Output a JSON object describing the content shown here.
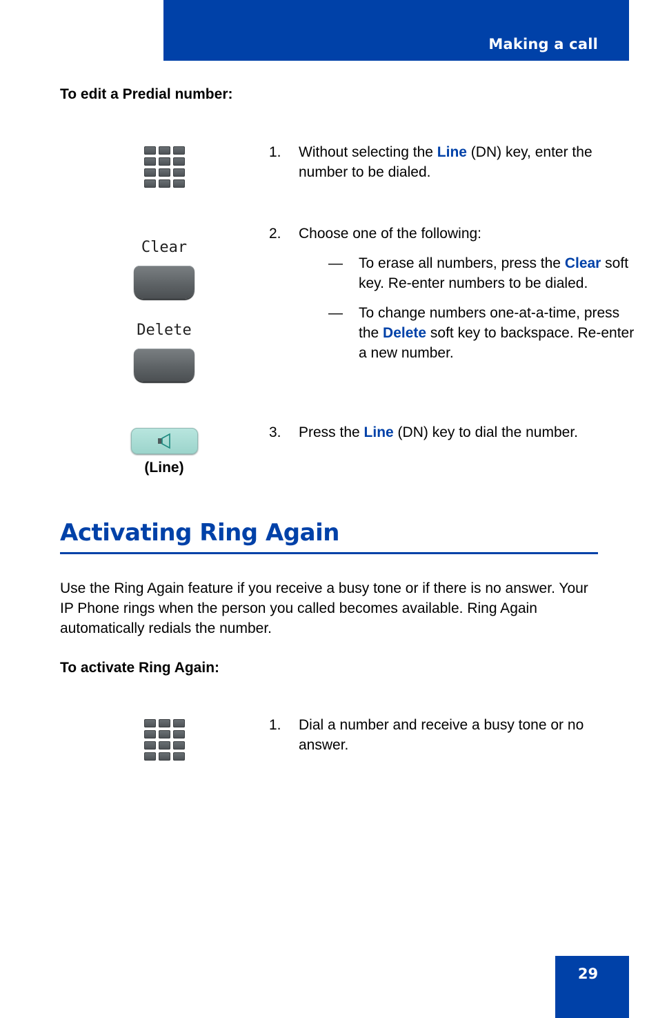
{
  "header": {
    "title": "Making a call"
  },
  "section1": {
    "subheading": "To edit a Predial number:",
    "steps": [
      {
        "number": "1.",
        "text_before": "Without selecting the ",
        "highlight": "Line",
        "text_after": " (DN) key, enter the number to be dialed.",
        "icon": "keypad-icon"
      },
      {
        "number": "2.",
        "text": "Choose one of the following:",
        "options": [
          {
            "dash": "—",
            "text_before": "To erase all numbers, press the ",
            "highlight": "Clear",
            "text_after": " soft key. Re-enter numbers to be dialed.",
            "key_label": "Clear"
          },
          {
            "dash": "—",
            "text_before": "To change numbers one-at-a-time, press the ",
            "highlight": "Delete",
            "text_after": " soft key to backspace. Re-enter a new number.",
            "key_label": "Delete"
          }
        ]
      },
      {
        "number": "3.",
        "text_before": "Press the ",
        "highlight": "Line",
        "text_after": " (DN) key to dial the number.",
        "key_caption": "(Line)",
        "icon": "speaker-icon"
      }
    ]
  },
  "section2": {
    "title": "Activating Ring Again",
    "paragraph": "Use the Ring Again feature if you receive a busy tone or if there is no answer. Your IP Phone rings when the person you called becomes available. Ring Again automatically redials the number.",
    "subheading": "To activate Ring Again:",
    "steps": [
      {
        "number": "1.",
        "text": "Dial a number and receive a busy tone or no answer.",
        "icon": "keypad-icon"
      }
    ]
  },
  "footer": {
    "page_number": "29"
  },
  "colors": {
    "brand_blue": "#0041a8"
  }
}
